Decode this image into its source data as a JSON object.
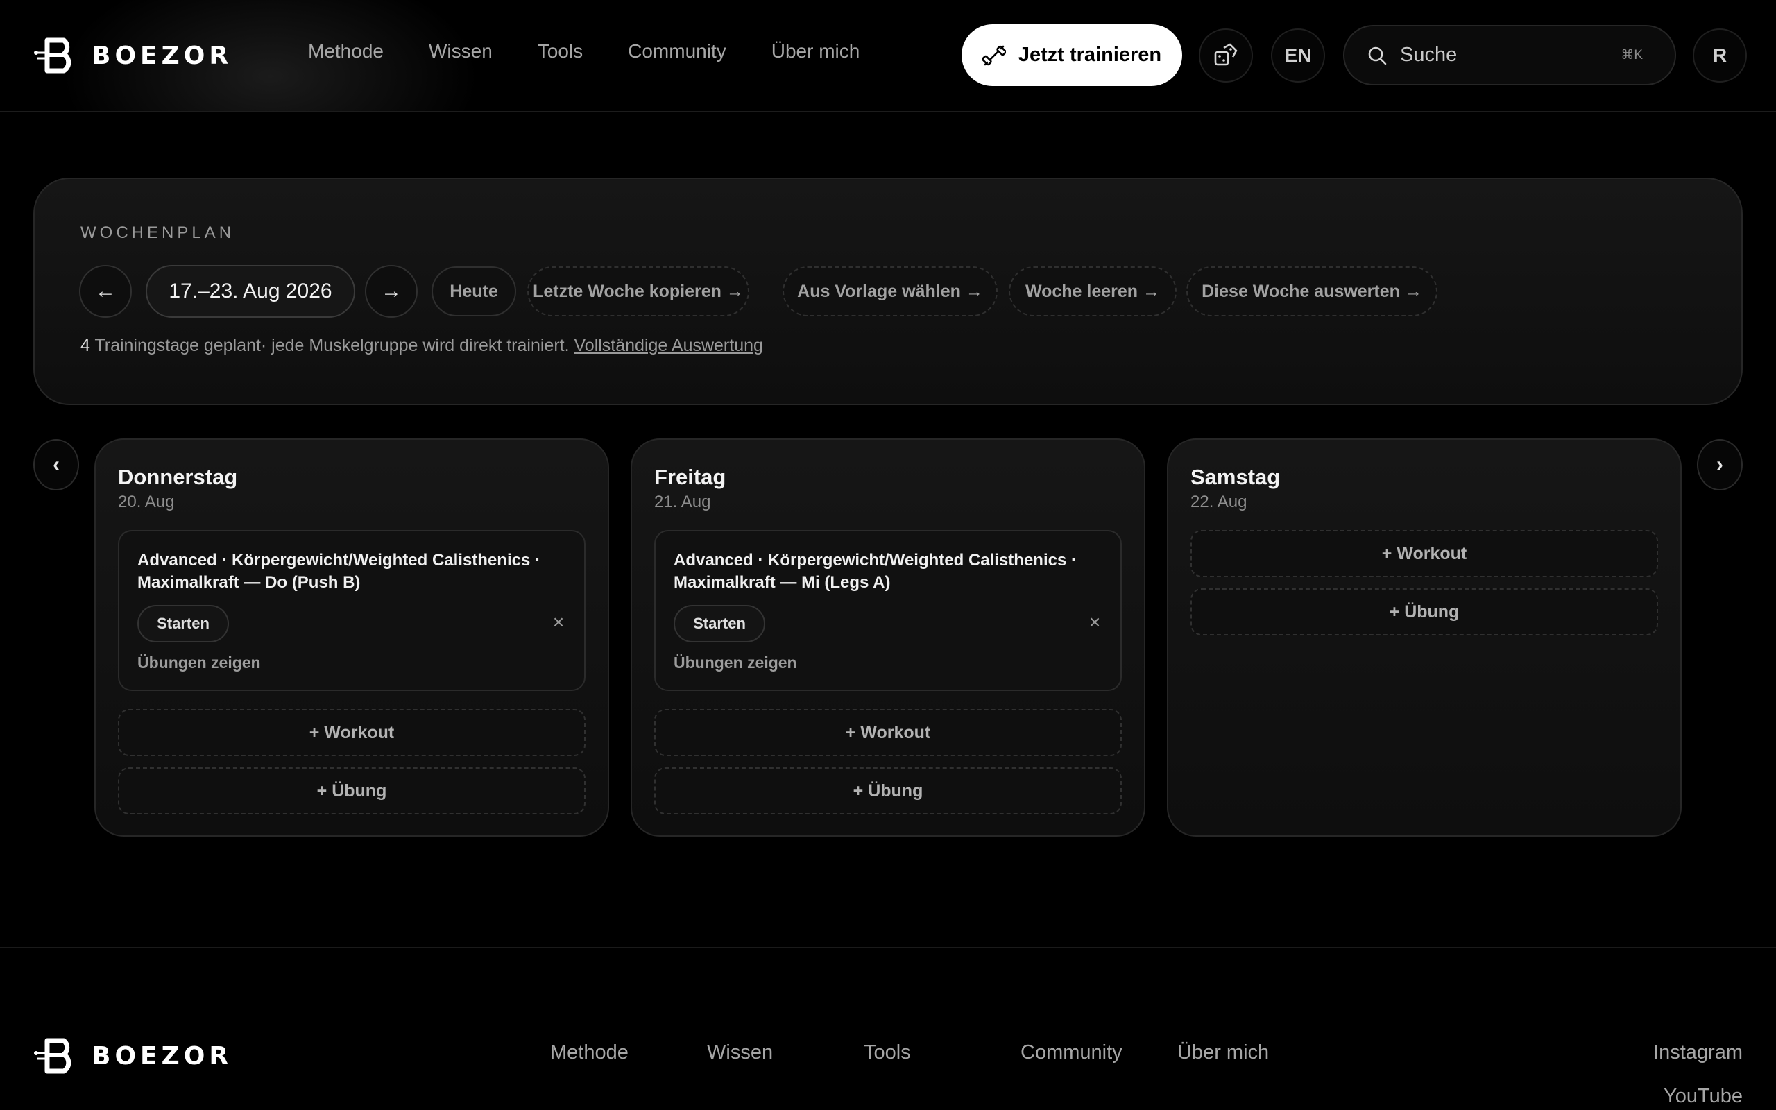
{
  "header": {
    "brand": "BOEZOR",
    "nav": [
      "Methode",
      "Wissen",
      "Tools",
      "Community",
      "Über mich"
    ],
    "cta_label": "Jetzt trainieren",
    "language": "EN",
    "search_placeholder": "Suche",
    "search_shortcut": "⌘K",
    "avatar_initial": "R"
  },
  "weekplan": {
    "title": "WOCHENPLAN",
    "prev_icon": "←",
    "next_icon": "→",
    "date_range": "17.–23. Aug 2026",
    "today": "Heute",
    "actions": [
      "Letzte Woche kopieren →",
      "Aus Vorlage wählen →",
      "Woche leeren →",
      "Diese Woche auswerten →"
    ],
    "summary_count": "4",
    "summary_text": " Trainingstage geplant· jede Muskelgruppe wird direkt trainiert. ",
    "summary_link": "Vollständige Auswertung"
  },
  "carousel": {
    "prev_icon": "‹",
    "next_icon": "›",
    "days": [
      {
        "name": "Donnerstag",
        "date": "20. Aug",
        "workout": {
          "title": "Advanced · Körpergewicht/Weighted Calisthenics · Maximalkraft — Do (Push B)",
          "start_label": "Starten",
          "remove_icon": "×",
          "show_label": "Übungen zeigen"
        },
        "add_workout": "+ Workout",
        "add_exercise": "+ Übung"
      },
      {
        "name": "Freitag",
        "date": "21. Aug",
        "workout": {
          "title": "Advanced · Körpergewicht/Weighted Calisthenics · Maximalkraft — Mi (Legs A)",
          "start_label": "Starten",
          "remove_icon": "×",
          "show_label": "Übungen zeigen"
        },
        "add_workout": "+ Workout",
        "add_exercise": "+ Übung"
      },
      {
        "name": "Samstag",
        "date": "22. Aug",
        "add_workout": "+ Workout",
        "add_exercise": "+ Übung"
      }
    ]
  },
  "footer": {
    "brand": "BOEZOR",
    "nav": [
      "Methode",
      "Wissen",
      "Tools",
      "Community",
      "Über mich"
    ],
    "social": [
      "Instagram",
      "YouTube"
    ]
  },
  "icons": {
    "cta": "dumbbell-icon",
    "tool": "dice-icon",
    "search": "search-icon"
  },
  "colors": {
    "background": "#000000",
    "card": "#141414",
    "accent": "#ffffff",
    "muted_text": "#9a9a9a"
  }
}
